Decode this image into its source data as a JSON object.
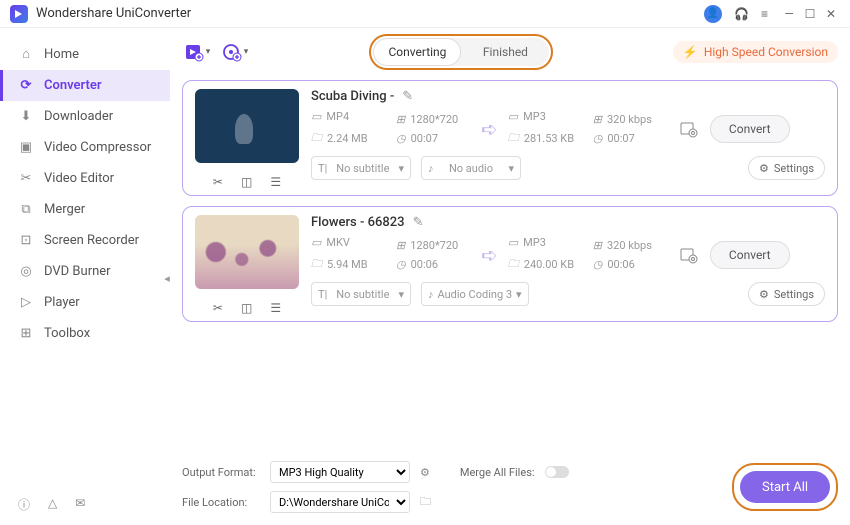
{
  "app": {
    "title": "Wondershare UniConverter"
  },
  "sidebar": {
    "items": [
      {
        "label": "Home"
      },
      {
        "label": "Converter"
      },
      {
        "label": "Downloader"
      },
      {
        "label": "Video Compressor"
      },
      {
        "label": "Video Editor"
      },
      {
        "label": "Merger"
      },
      {
        "label": "Screen Recorder"
      },
      {
        "label": "DVD Burner"
      },
      {
        "label": "Player"
      },
      {
        "label": "Toolbox"
      }
    ]
  },
  "tabs": {
    "converting": "Converting",
    "finished": "Finished"
  },
  "hsc": "High Speed Conversion",
  "items": [
    {
      "title": "Scuba Diving -",
      "src_format": "MP4",
      "src_res": "1280*720",
      "src_size": "2.24 MB",
      "src_dur": "00:07",
      "dst_format": "MP3",
      "dst_bitrate": "320 kbps",
      "dst_size": "281.53 KB",
      "dst_dur": "00:07",
      "subtitle": "No subtitle",
      "audio": "No audio",
      "settings": "Settings",
      "convert": "Convert"
    },
    {
      "title": "Flowers - 66823",
      "src_format": "MKV",
      "src_res": "1280*720",
      "src_size": "5.94 MB",
      "src_dur": "00:06",
      "dst_format": "MP3",
      "dst_bitrate": "320 kbps",
      "dst_size": "240.00 KB",
      "dst_dur": "00:06",
      "subtitle": "No subtitle",
      "audio": "Audio Coding 3",
      "settings": "Settings",
      "convert": "Convert"
    }
  ],
  "footer": {
    "output_format_label": "Output Format:",
    "output_format": "MP3 High Quality",
    "file_location_label": "File Location:",
    "file_location": "D:\\Wondershare UniConverter",
    "merge_label": "Merge All Files:",
    "start_all": "Start All"
  }
}
